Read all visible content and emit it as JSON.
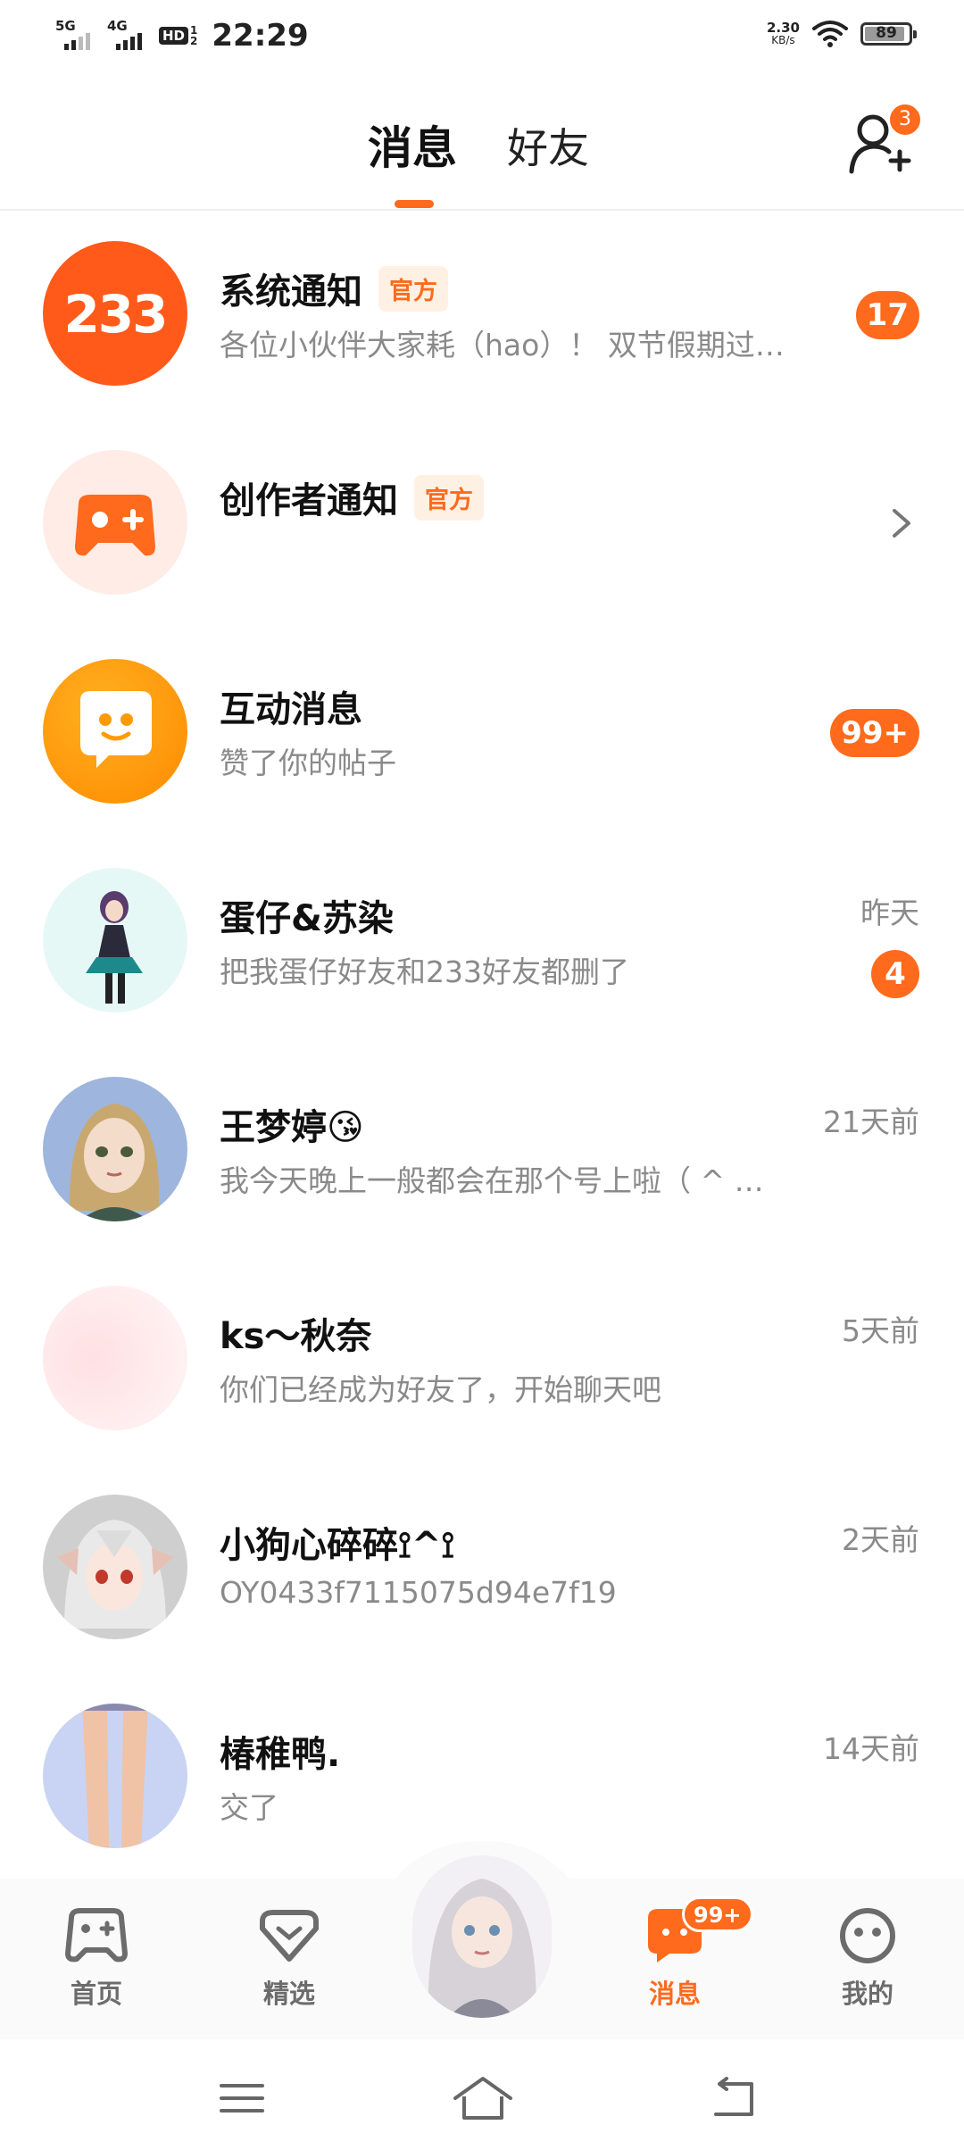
{
  "status_bar": {
    "net1": "5G",
    "net2": "4G",
    "hd": "HD",
    "hd_sub1": "1",
    "hd_sub2": "2",
    "time": "22:29",
    "speed_value": "2.30",
    "speed_unit": "KB/s",
    "battery": "89",
    "battery_level_percent": 89
  },
  "header": {
    "tab_messages": "消息",
    "tab_friends": "好友",
    "add_friend_badge": "3"
  },
  "conversations": [
    {
      "name": "系统通知",
      "tag": "官方",
      "preview": "各位小伙伴大家耗（hao）！ 双节假期过…",
      "time": "",
      "badge": "17"
    },
    {
      "name": "创作者通知",
      "tag": "官方",
      "preview": "",
      "time": "",
      "badge": ""
    },
    {
      "name": "互动消息",
      "tag": "",
      "preview": "赞了你的帖子",
      "time": "",
      "badge": "99+"
    },
    {
      "name": "蛋仔&苏染",
      "tag": "",
      "preview": "把我蛋仔好友和233好友都删了",
      "time": "昨天",
      "badge": "4"
    },
    {
      "name": "王梦婷😘",
      "tag": "",
      "preview": "我今天晚上一般都会在那个号上啦（ ^ …",
      "time": "21天前",
      "badge": ""
    },
    {
      "name": "ks～秋奈",
      "tag": "",
      "preview": "你们已经成为好友了，开始聊天吧",
      "time": "5天前",
      "badge": ""
    },
    {
      "name": "小狗心碎碎⟟^⟟",
      "tag": "",
      "preview": "OY0433f7115075d94e7f19",
      "time": "2天前",
      "badge": ""
    },
    {
      "name": "椿稚鸭.",
      "tag": "",
      "preview": "交了",
      "time": "14天前",
      "badge": ""
    }
  ],
  "avatars": {
    "system_logo_text": "233"
  },
  "bottom_nav": {
    "home": "首页",
    "featured": "精选",
    "messages": "消息",
    "messages_badge": "99+",
    "mine": "我的"
  },
  "colors": {
    "accent": "#ff6a1c",
    "tag_bg": "#fff0e4",
    "muted_text": "#8a8a8a"
  },
  "icons": {
    "add_friend": "add-user-icon",
    "chevron": "chevron-right-icon",
    "home": "gamepad-icon",
    "featured": "heart-box-icon",
    "messages": "chat-bubble-icon",
    "mine": "face-icon",
    "sys_menu": "menu-icon",
    "sys_home": "home-icon",
    "sys_back": "back-icon"
  }
}
